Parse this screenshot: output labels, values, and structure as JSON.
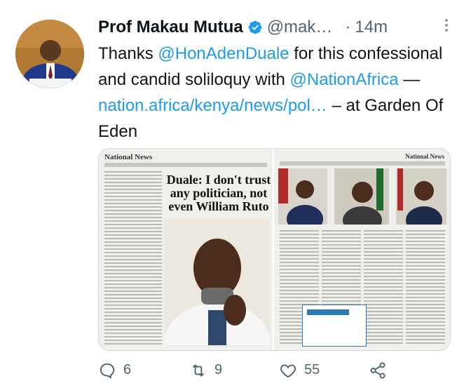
{
  "tweet": {
    "author_name": "Prof Makau Mutua",
    "handle": "@mak…",
    "separator": "·",
    "time": "14m",
    "text_parts": {
      "p1": "Thanks ",
      "mention1": "@HonAdenDuale",
      "p2": " for this confessional and candid soliloquy with ",
      "mention2": "@NationAfrica",
      "p3": " — ",
      "url": "nation.africa/kenya/news/pol…",
      "p4": " – at Garden Of Eden"
    },
    "media": {
      "left_masthead": "National News",
      "left_headline": "Duale: I don't trust any politician, not even William Ruto",
      "right_masthead": "National News"
    },
    "stats": {
      "replies": "6",
      "retweets": "9",
      "likes": "55"
    }
  },
  "colors": {
    "link": "#1d9bf0",
    "text": "#0f1419",
    "muted": "#536471"
  },
  "icons": [
    "verified-badge-icon",
    "more-options-icon",
    "reply-icon",
    "retweet-icon",
    "like-icon",
    "share-icon"
  ]
}
